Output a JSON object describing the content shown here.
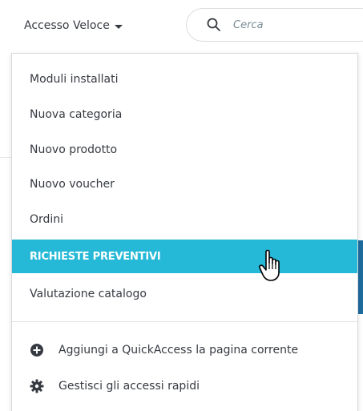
{
  "topbar": {
    "quick_access_label": "Accesso Veloce",
    "search_placeholder": "Cerca"
  },
  "menu": {
    "items": [
      {
        "label": "Moduli installati"
      },
      {
        "label": "Nuova categoria"
      },
      {
        "label": "Nuovo prodotto"
      },
      {
        "label": "Nuovo voucher"
      },
      {
        "label": "Ordini"
      },
      {
        "label": "RICHIESTE PREVENTIVI"
      },
      {
        "label": "Valutazione catalogo"
      }
    ],
    "actions": [
      {
        "label": "Aggiungi a QuickAccess la pagina corrente",
        "icon": "plus-circle-icon"
      },
      {
        "label": "Gestisci gli accessi rapidi",
        "icon": "gear-icon"
      }
    ]
  },
  "colors": {
    "active_bg": "#25b9d7",
    "text": "#363a41"
  }
}
